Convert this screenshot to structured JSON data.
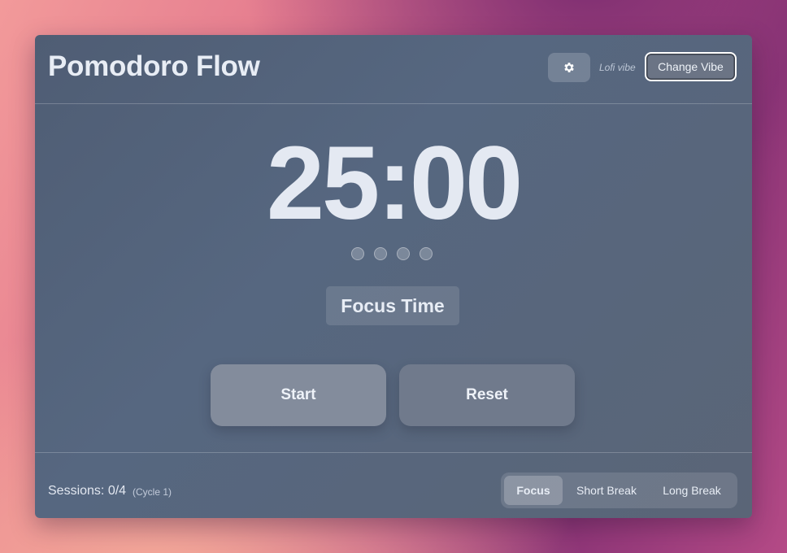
{
  "app": {
    "title": "Pomodoro Flow"
  },
  "header": {
    "settings_icon": "gear-icon",
    "vibe_label": "Lofi vibe",
    "change_vibe_label": "Change Vibe"
  },
  "timer": {
    "display": "25:00",
    "session_dots_total": 4,
    "session_dots_filled": 0,
    "mode_label": "Focus Time"
  },
  "controls": {
    "start_label": "Start",
    "reset_label": "Reset"
  },
  "footer": {
    "sessions_text": "Sessions: 0/4",
    "cycle_text": "(Cycle 1)",
    "modes": [
      {
        "label": "Focus",
        "active": true
      },
      {
        "label": "Short Break",
        "active": false
      },
      {
        "label": "Long Break",
        "active": false
      }
    ]
  },
  "colors": {
    "card_bg": "#566780",
    "text_primary": "#e8edf5",
    "start_button": "#838c9c",
    "reset_button": "#707a8c"
  }
}
